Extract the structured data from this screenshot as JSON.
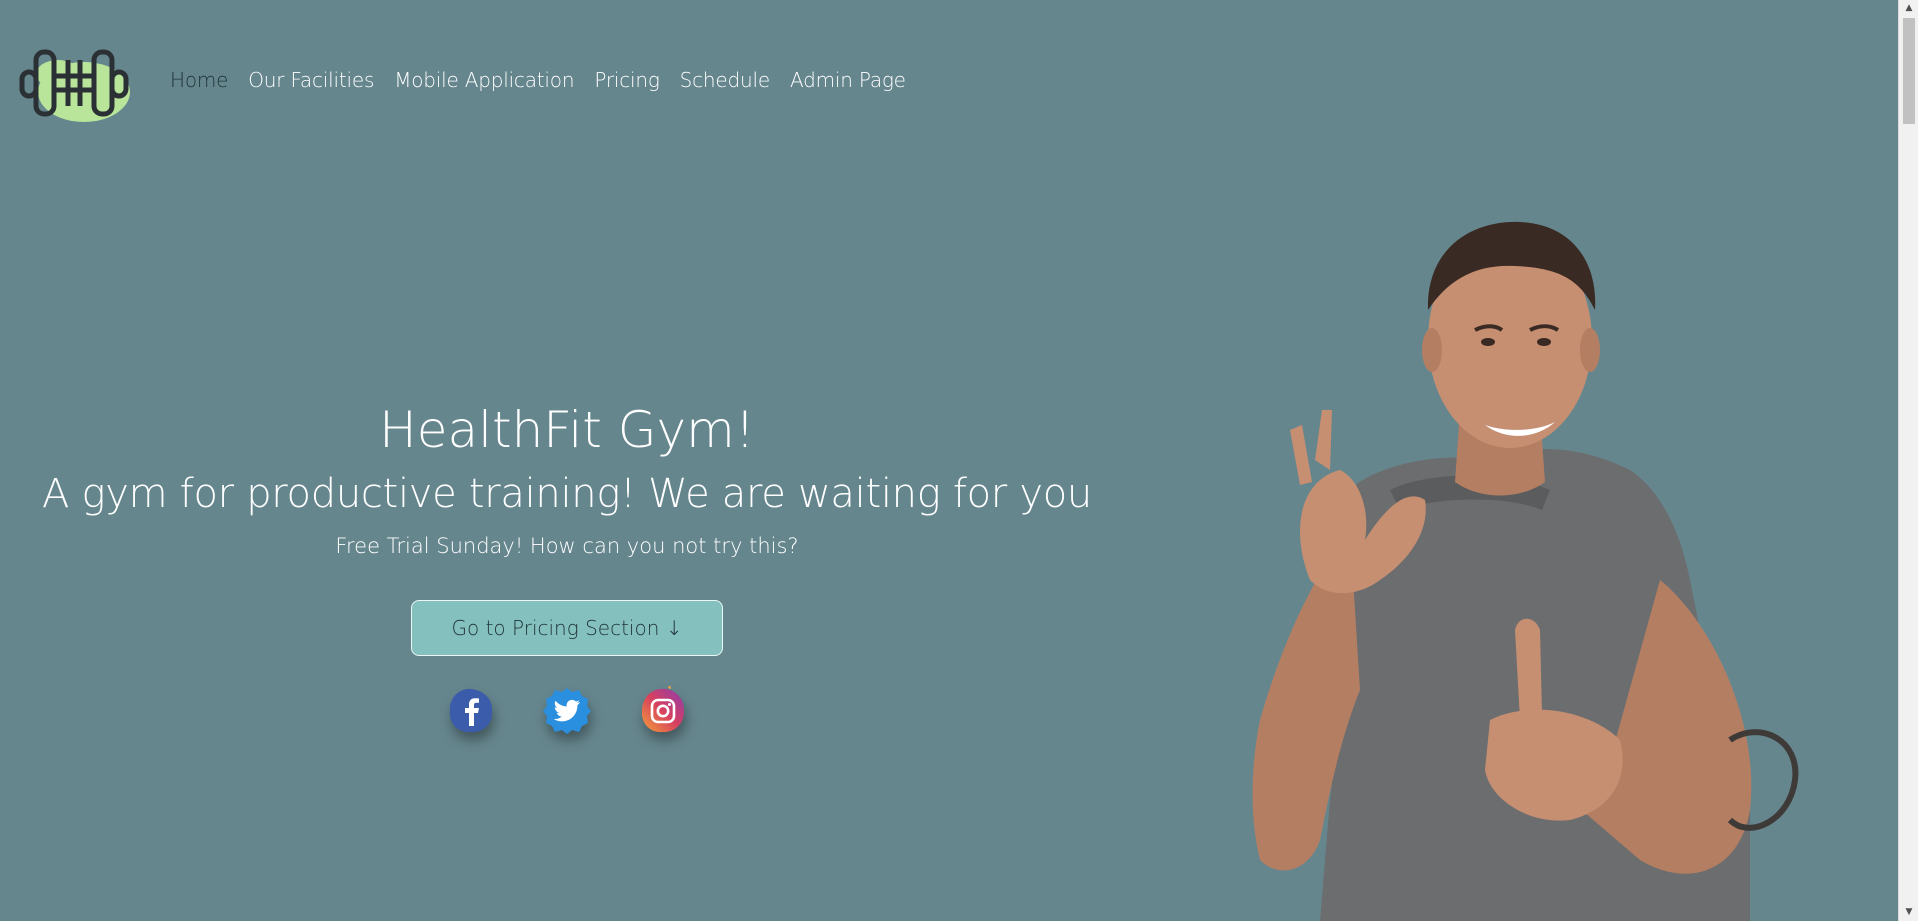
{
  "nav": {
    "logo_icon": "dumbbell-logo-icon",
    "items": [
      {
        "label": "Home",
        "active": true
      },
      {
        "label": "Our Facilities"
      },
      {
        "label": "Mobile Application"
      },
      {
        "label": "Pricing"
      },
      {
        "label": "Schedule"
      },
      {
        "label": "Admin Page"
      }
    ]
  },
  "hero": {
    "title": "HealthFit Gym!",
    "subtitle": "A gym for productive training! We are waiting for you",
    "tagline": "Free Trial Sunday! How can you not try this?",
    "cta_label": "Go to Pricing Section ↓"
  },
  "social": [
    {
      "icon": "facebook-icon",
      "color": "#3b5bab"
    },
    {
      "icon": "twitter-icon",
      "color": "#2a8fdf"
    },
    {
      "icon": "instagram-icon",
      "color": "#d6405e"
    }
  ],
  "colors": {
    "background": "#66868e",
    "cta_bg": "#84c1be",
    "logo_accent": "#b9e59a"
  }
}
